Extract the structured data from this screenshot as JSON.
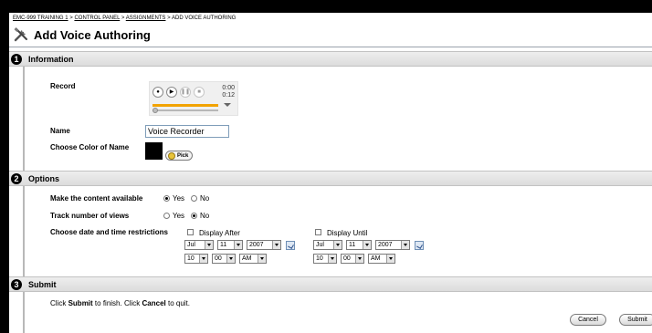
{
  "breadcrumb": {
    "course": "EMC-999 TRAINING 1",
    "panel": "CONTROL PANEL",
    "assignments": "ASSIGNMENTS",
    "current": "ADD VOICE AUTHORING",
    "sep": ">"
  },
  "page": {
    "title": "Add Voice Authoring",
    "icon": "tools-icon"
  },
  "information": {
    "step": "1",
    "title": "Information",
    "record_label": "Record",
    "player": {
      "elapsed": "0:00",
      "total": "0:12",
      "progress": 1.0,
      "position": 0.0,
      "buttons": [
        "record",
        "play",
        "pause",
        "stop"
      ]
    },
    "name_label": "Name",
    "name_value": "Voice Recorder",
    "color_label": "Choose Color of Name",
    "color_value": "#000000",
    "pick_label": "Pick"
  },
  "options": {
    "step": "2",
    "title": "Options",
    "available_label": "Make the content available",
    "available_selected": "Yes",
    "track_label": "Track number of views",
    "track_selected": "No",
    "yes": "Yes",
    "no": "No",
    "restrict_label": "Choose date and time restrictions",
    "after": {
      "label": "Display After",
      "checked": false,
      "month": "Jul",
      "day": "11",
      "year": "2007",
      "hour": "10",
      "minute": "00",
      "ampm": "AM"
    },
    "until": {
      "label": "Display Until",
      "checked": false,
      "month": "Jul",
      "day": "11",
      "year": "2007",
      "hour": "10",
      "minute": "00",
      "ampm": "AM"
    }
  },
  "submit": {
    "step": "3",
    "title": "Submit",
    "text": {
      "click1": "Click",
      "submit": "Submit",
      "mid": "to finish. Click",
      "cancel": "Cancel",
      "end": "to quit."
    },
    "cancel_button": "Cancel",
    "submit_button": "Submit"
  }
}
